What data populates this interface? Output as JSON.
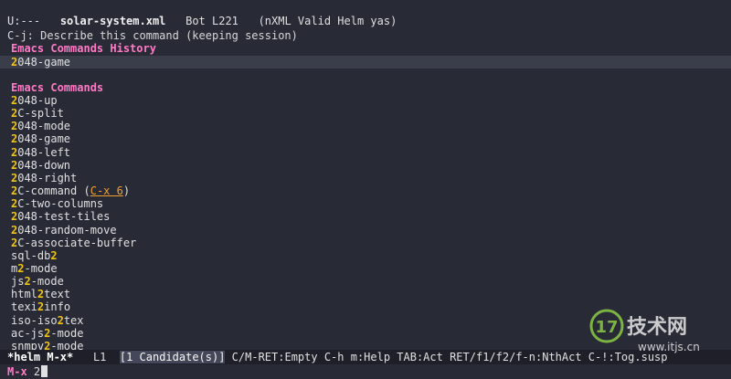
{
  "modeline_top": {
    "status": "U:---",
    "buffer": "solar-system.xml",
    "position": "Bot L221",
    "modes": "(nXML Valid Helm yas)"
  },
  "hint": "C-j: Describe this command (keeping session)",
  "history": {
    "title": "Emacs Commands History",
    "items": [
      {
        "match": "2",
        "rest": "048-game"
      }
    ]
  },
  "commands": {
    "title": "Emacs Commands",
    "items": [
      {
        "pre": "",
        "match": "2",
        "rest": "048-up"
      },
      {
        "pre": "",
        "match": "2",
        "rest": "C-split"
      },
      {
        "pre": "",
        "match": "2",
        "rest": "048-mode"
      },
      {
        "pre": "",
        "match": "2",
        "rest": "048-game"
      },
      {
        "pre": "",
        "match": "2",
        "rest": "048-left"
      },
      {
        "pre": "",
        "match": "2",
        "rest": "048-down"
      },
      {
        "pre": "",
        "match": "2",
        "rest": "048-right"
      },
      {
        "pre": "",
        "match": "2",
        "rest": "C-command (",
        "key": "C-x 6",
        "post": ")"
      },
      {
        "pre": "",
        "match": "2",
        "rest": "C-two-columns"
      },
      {
        "pre": "",
        "match": "2",
        "rest": "048-test-tiles"
      },
      {
        "pre": "",
        "match": "2",
        "rest": "048-random-move"
      },
      {
        "pre": "",
        "match": "2",
        "rest": "C-associate-buffer"
      },
      {
        "pre": "sql-db",
        "match": "2",
        "rest": ""
      },
      {
        "pre": "m",
        "match": "2",
        "rest": "-mode"
      },
      {
        "pre": "js",
        "match": "2",
        "rest": "-mode"
      },
      {
        "pre": "html",
        "match": "2",
        "rest": "text"
      },
      {
        "pre": "texi",
        "match": "2",
        "rest": "info"
      },
      {
        "pre": "iso-iso",
        "match": "2",
        "rest": "tex"
      },
      {
        "pre": "ac-js",
        "match": "2",
        "rest": "-mode"
      },
      {
        "pre": "snmpv",
        "match": "2",
        "rest": "-mode"
      }
    ]
  },
  "statusbar": {
    "mode": "*helm M-x*",
    "line": "L1",
    "candidates": "[1 Candidate(s)]",
    "help": "C/M-RET:Empty C-h m:Help TAB:Act RET/f1/f2/f-n:NthAct C-!:Tog.susp"
  },
  "minibuffer": {
    "prompt": "M-x",
    "input": "2"
  },
  "watermark": {
    "logo_number": "17",
    "logo_text": "技术网",
    "url": "www.itjs.cn",
    "colors": {
      "green": "#7cb342",
      "gray": "#e8e8e8"
    }
  },
  "colors": {
    "background": "#282a36",
    "header": "#ff79c6",
    "match": "#f1c40f",
    "key": "#f0a030"
  }
}
